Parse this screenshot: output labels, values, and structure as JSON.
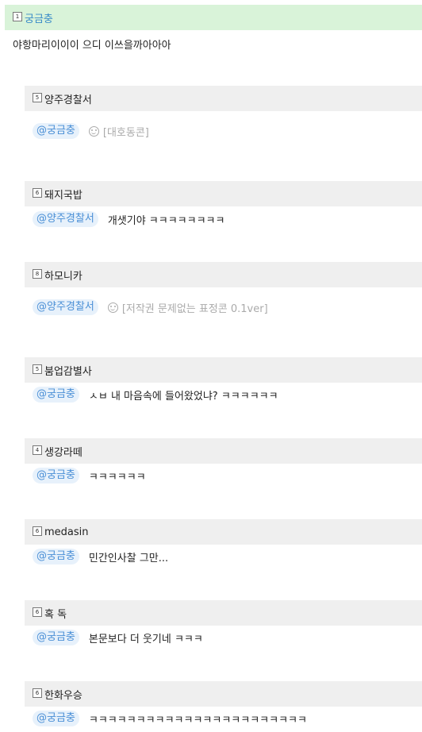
{
  "post": {
    "level": "1",
    "nickname": "궁금충",
    "text": "야항마리이이이 으디 이쓰을까아아아"
  },
  "comments": [
    {
      "level": "5",
      "nickname": "양주경찰서",
      "mention": "@궁금충",
      "emoticon": true,
      "text": "[대호동콘]"
    },
    {
      "level": "6",
      "nickname": "돼지국밥",
      "mention": "@양주경찰서",
      "emoticon": false,
      "text": "개샛기야 ㅋㅋㅋㅋㅋㅋㅋㅋ"
    },
    {
      "level": "8",
      "nickname": "하모니카",
      "mention": "@양주경찰서",
      "emoticon": true,
      "text": "[저작권 문제없는 표정콘 0.1ver]"
    },
    {
      "level": "5",
      "nickname": "붐업감별사",
      "mention": "@궁금충",
      "emoticon": false,
      "text": "ㅅㅂ 내 마음속에 들어왔었냐? ㅋㅋㅋㅋㅋㅋ"
    },
    {
      "level": "4",
      "nickname": "생강라떼",
      "mention": "@궁금충",
      "emoticon": false,
      "text": "ㅋㅋㅋㅋㅋㅋ"
    },
    {
      "level": "6",
      "nickname": "medasin",
      "mention": "@궁금충",
      "emoticon": false,
      "text": "민간인사찰 그만..."
    },
    {
      "level": "6",
      "nickname": "혹 독",
      "mention": "@궁금충",
      "emoticon": false,
      "text": "본문보다 더 웃기네 ㅋㅋㅋ"
    },
    {
      "level": "6",
      "nickname": "한화우승",
      "mention": "@궁금충",
      "emoticon": false,
      "text": "ㅋㅋㅋㅋㅋㅋㅋㅋㅋㅋㅋㅋㅋㅋㅋㅋㅋㅋㅋㅋㅋㅋㅋ"
    }
  ]
}
